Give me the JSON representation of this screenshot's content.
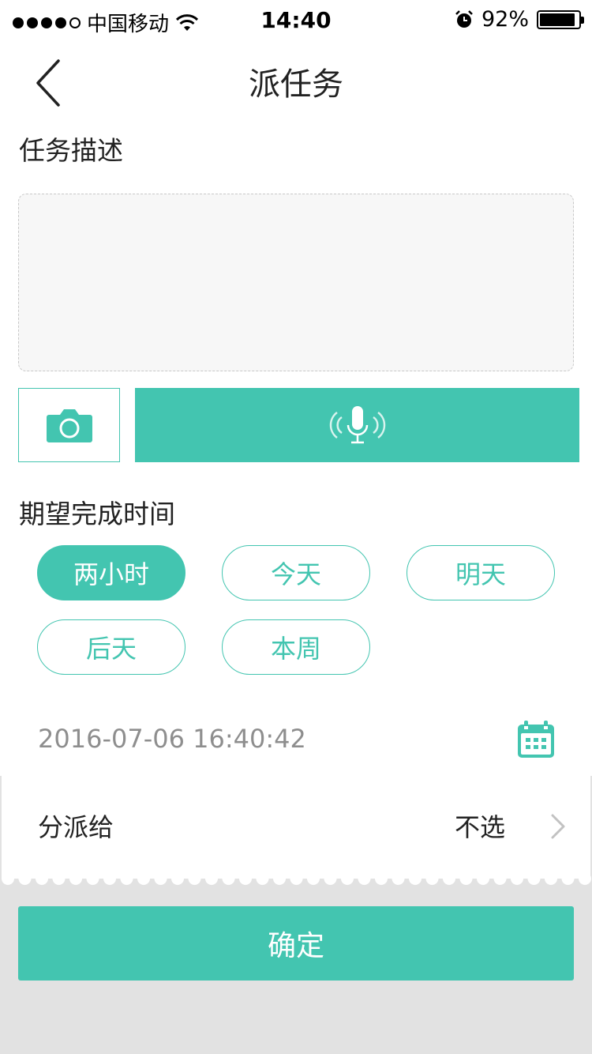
{
  "status_bar": {
    "carrier": "中国移动",
    "time": "14:40",
    "battery_percent": "92%",
    "battery_level": 0.92
  },
  "nav": {
    "title": "派任务"
  },
  "task_description": {
    "label": "任务描述",
    "placeholder": ""
  },
  "expected_time": {
    "label": "期望完成时间",
    "options": [
      "两小时",
      "今天",
      "明天",
      "后天",
      "本周"
    ],
    "selected": "两小时",
    "datetime_value": "2016-07-06 16:40:42"
  },
  "assign": {
    "label": "分派给",
    "value": "不选"
  },
  "confirm_label": "确定",
  "colors": {
    "accent": "#43c5b0",
    "background_gray": "#e2e2e2",
    "input_bg": "#f7f7f7",
    "muted_text": "#8e8e8e"
  },
  "icons": {
    "back": "chevron-left-icon",
    "camera": "camera-icon",
    "microphone": "microphone-icon",
    "calendar": "calendar-icon",
    "chevron_right": "chevron-right-icon",
    "wifi": "wifi-icon",
    "alarm": "alarm-icon",
    "battery": "battery-icon"
  }
}
